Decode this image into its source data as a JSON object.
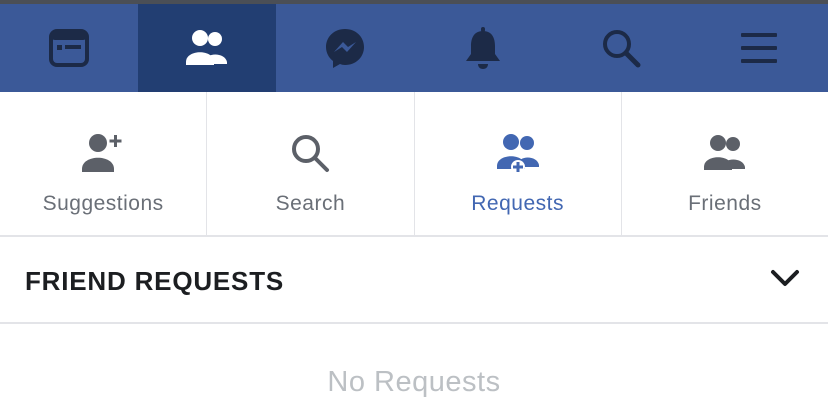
{
  "topbar": {
    "items": [
      {
        "icon": "news-feed-icon"
      },
      {
        "icon": "friends-icon",
        "active": true
      },
      {
        "icon": "messenger-icon"
      },
      {
        "icon": "notifications-bell-icon"
      },
      {
        "icon": "search-icon"
      },
      {
        "icon": "menu-icon"
      }
    ],
    "colors": {
      "bar": "#3b5998",
      "active": "#223e72",
      "icon": "#1c2a47"
    }
  },
  "subtabs": {
    "items": [
      {
        "label": "Suggestions",
        "icon": "add-friend-icon"
      },
      {
        "label": "Search",
        "icon": "search-icon"
      },
      {
        "label": "Requests",
        "icon": "friend-requests-icon",
        "active": true
      },
      {
        "label": "Friends",
        "icon": "friends-icon"
      }
    ],
    "colors": {
      "label": "#6a6f77",
      "active": "#4267b2"
    }
  },
  "section": {
    "title": "FRIEND REQUESTS",
    "toggle_icon": "chevron-down-icon"
  },
  "empty_state": {
    "text": "No Requests"
  }
}
